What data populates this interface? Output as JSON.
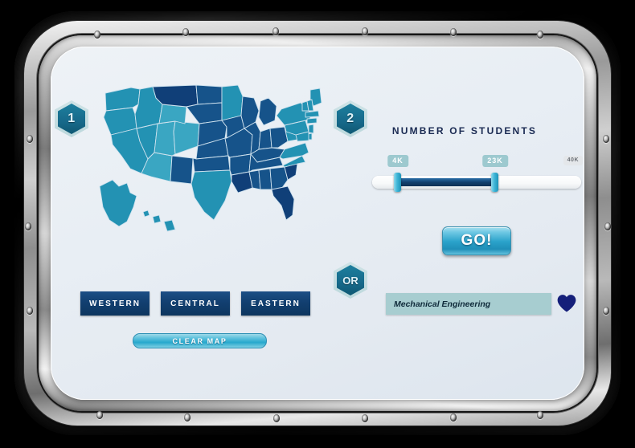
{
  "app": {
    "frame_style": "metal-porthole-bezel",
    "screen_bg": "#e9eef4"
  },
  "steps": {
    "one": {
      "label": "1",
      "name": "step-1-badge"
    },
    "two": {
      "label": "2",
      "name": "step-2-badge"
    },
    "or": {
      "label": "OR",
      "name": "or-badge"
    }
  },
  "map": {
    "name": "us-states-map",
    "title": "United States map",
    "colors": {
      "light": "#2b95b5",
      "medium": "#1e7ba3",
      "dark": "#17578c",
      "darkest": "#103f78",
      "stroke": "#cfe2ee"
    },
    "regions": [
      "Western",
      "Central",
      "Eastern"
    ]
  },
  "region_buttons": [
    {
      "label": "WESTERN",
      "name": "region-button-western"
    },
    {
      "label": "CENTRAL",
      "name": "region-button-central"
    },
    {
      "label": "EASTERN",
      "name": "region-button-eastern"
    }
  ],
  "clear_map": {
    "label": "CLEAR MAP"
  },
  "students": {
    "title": "NUMBER OF STUDENTS",
    "min_label": "4K",
    "max_label": "23K",
    "scale_max_label": "40K",
    "min_value": 4000,
    "max_value": 23000,
    "scale_min": 0,
    "scale_max": 40000,
    "handle_left_pct": 12,
    "handle_right_pct": 58
  },
  "go": {
    "label": "GO!"
  },
  "search": {
    "value": "Mechanical Engineering",
    "placeholder": "Mechanical Engineering"
  },
  "favorite": {
    "name": "heart-icon",
    "color": "#151f7a"
  },
  "colors": {
    "accent_blue": "#12406e",
    "accent_cyan": "#2ba3cb",
    "badge_teal": "#17698a",
    "field_teal": "#a7cdd0",
    "heart_navy": "#151f7a"
  }
}
